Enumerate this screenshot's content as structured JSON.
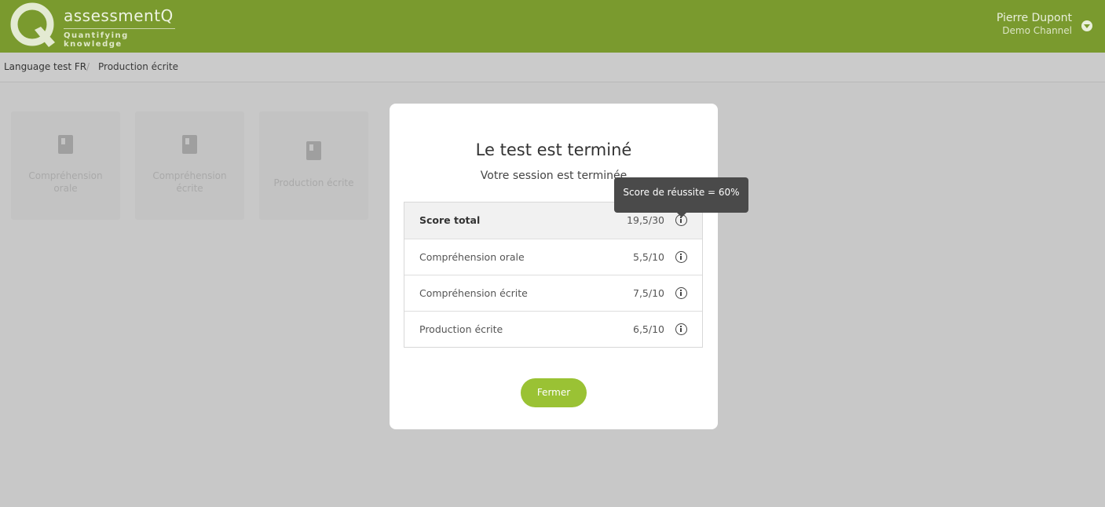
{
  "header": {
    "brand_name": "assessmentQ",
    "brand_tagline": "Quantifying knowledge",
    "user_name": "Pierre Dupont",
    "user_channel": "Demo Channel",
    "accent_color": "#7a9a2e"
  },
  "breadcrumb": {
    "items": [
      "Language test FR",
      "Production écrite"
    ],
    "separator": "/"
  },
  "cards": [
    {
      "label_line1": "Compréhension",
      "label_line2": "orale",
      "icon": "book-icon"
    },
    {
      "label_line1": "Compréhension",
      "label_line2": "écrite",
      "icon": "book-icon"
    },
    {
      "label_line1": "Production écrite",
      "label_line2": "",
      "icon": "book-icon"
    }
  ],
  "modal": {
    "title": "Le test est terminé",
    "subtitle": "Votre session est terminée",
    "rows": [
      {
        "label": "Score total",
        "value": "19,5/30"
      },
      {
        "label": "Compréhension orale",
        "value": "5,5/10"
      },
      {
        "label": "Compréhension écrite",
        "value": "7,5/10"
      },
      {
        "label": "Production écrite",
        "value": "6,5/10"
      }
    ],
    "close_label": "Fermer",
    "button_color": "#9ac234"
  },
  "tooltip": {
    "text": "Score de réussite = 60%"
  }
}
